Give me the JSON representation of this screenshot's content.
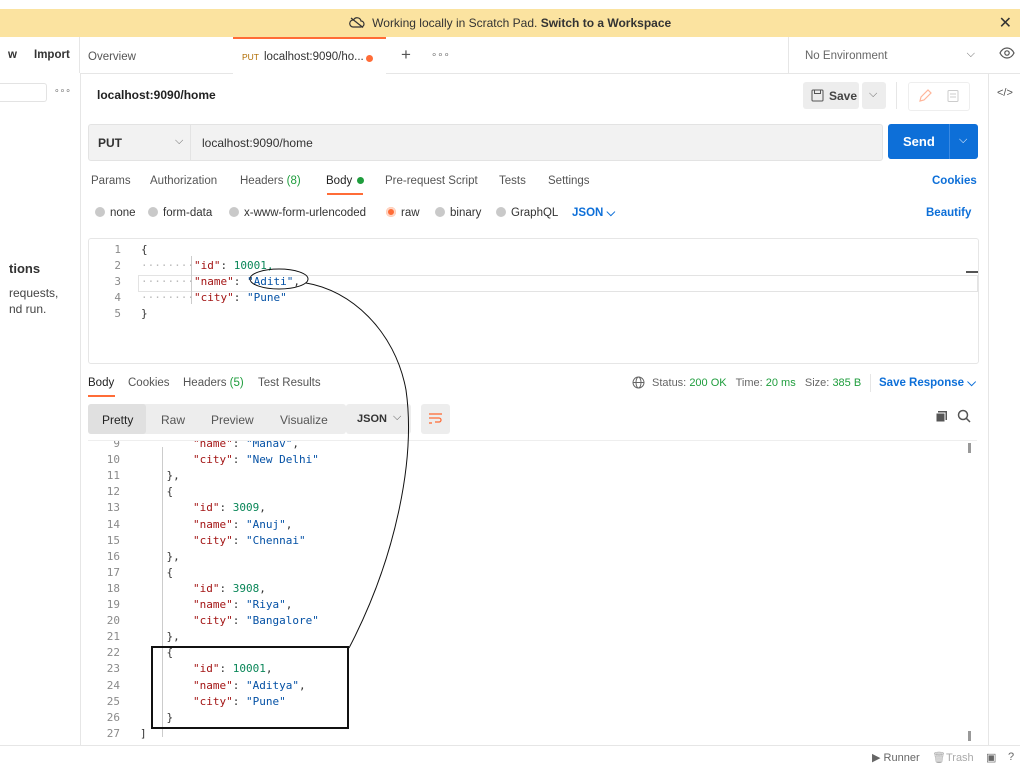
{
  "banner": {
    "icon": "cloud-off-icon",
    "text": "Working locally in Scratch Pad.",
    "link": "Switch to a Workspace",
    "close": "✕"
  },
  "sidebar": {
    "new_label": "w",
    "import_label": "Import",
    "more": "∘∘∘",
    "empty_title": "tions",
    "empty_line1": "requests,",
    "empty_line2": "nd run."
  },
  "tabs": {
    "overview": "Overview",
    "active_method": "PUT",
    "active_label": "localhost:9090/ho...",
    "new_tab": "+",
    "more": "∘∘∘"
  },
  "environment": {
    "label": "No Environment"
  },
  "request": {
    "title": "localhost:9090/home",
    "save_label": "Save",
    "method": "PUT",
    "url": "localhost:9090/home",
    "send_label": "Send"
  },
  "request_tabs": {
    "params": "Params",
    "authorization": "Authorization",
    "headers": "Headers",
    "headers_count": "(8)",
    "body": "Body",
    "prerequest": "Pre-request Script",
    "tests": "Tests",
    "settings": "Settings",
    "cookies": "Cookies"
  },
  "body_modes": {
    "none": "none",
    "form_data": "form-data",
    "urlencoded": "x-www-form-urlencoded",
    "raw": "raw",
    "binary": "binary",
    "graphql": "GraphQL",
    "json": "JSON",
    "beautify": "Beautify"
  },
  "editor": {
    "line_numbers": [
      "1",
      "2",
      "3",
      "4",
      "5"
    ],
    "open": "{",
    "id_key": "\"id\"",
    "id_val": "10001,",
    "name_key": "\"name\"",
    "name_val": "\"Aditi\"",
    "name_comma": ",",
    "city_key": "\"city\"",
    "city_val": "\"Pune\"",
    "close": "}"
  },
  "response": {
    "tabs": {
      "body": "Body",
      "cookies": "Cookies",
      "headers": "Headers",
      "headers_count": "(5)",
      "test_results": "Test Results"
    },
    "status_label": "Status:",
    "status_value": "200 OK",
    "time_label": "Time:",
    "time_value": "20 ms",
    "size_label": "Size:",
    "size_value": "385 B",
    "save_response": "Save Response",
    "views": {
      "pretty": "Pretty",
      "raw": "Raw",
      "preview": "Preview",
      "visualize": "Visualize"
    },
    "format": "JSON",
    "lines": [
      {
        "n": "9",
        "text": "        \"name\": \"Manav\","
      },
      {
        "n": "10",
        "text": "        \"city\": \"New Delhi\""
      },
      {
        "n": "11",
        "text": "    },"
      },
      {
        "n": "12",
        "text": "    {"
      },
      {
        "n": "13",
        "text": "        \"id\": 3009,"
      },
      {
        "n": "14",
        "text": "        \"name\": \"Anuj\","
      },
      {
        "n": "15",
        "text": "        \"city\": \"Chennai\""
      },
      {
        "n": "16",
        "text": "    },"
      },
      {
        "n": "17",
        "text": "    {"
      },
      {
        "n": "18",
        "text": "        \"id\": 3908,"
      },
      {
        "n": "19",
        "text": "        \"name\": \"Riya\","
      },
      {
        "n": "20",
        "text": "        \"city\": \"Bangalore\""
      },
      {
        "n": "21",
        "text": "    },"
      },
      {
        "n": "22",
        "text": "    {"
      },
      {
        "n": "23",
        "text": "        \"id\": 10001,"
      },
      {
        "n": "24",
        "text": "        \"name\": \"Aditya\","
      },
      {
        "n": "25",
        "text": "        \"city\": \"Pune\""
      },
      {
        "n": "26",
        "text": "    }"
      },
      {
        "n": "27",
        "text": "]"
      }
    ]
  },
  "footer": {
    "runner": "Runner",
    "trash": "Trash"
  },
  "colors": {
    "accent": "#ff6c37",
    "send": "#0d6fd8",
    "banner": "#fbe3a0",
    "ok": "#1f9d3d"
  }
}
